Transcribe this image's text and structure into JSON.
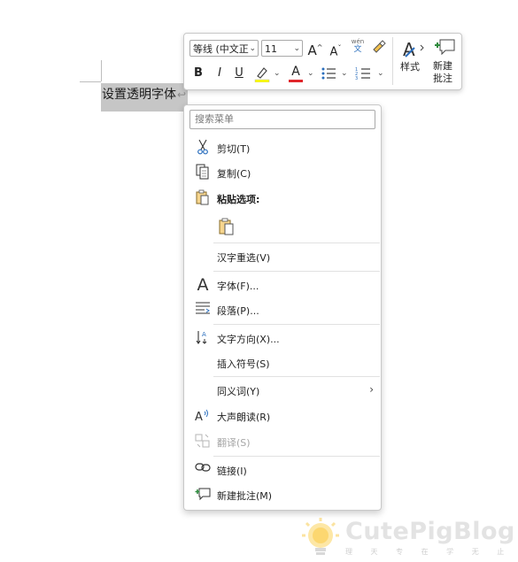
{
  "document": {
    "selected_text": "设置透明字体",
    "paragraph_mark": "↩"
  },
  "mini_toolbar": {
    "font_name": "等线 (中文正",
    "font_size": "11",
    "grow_font_icon": "grow-font-icon",
    "shrink_font_icon": "shrink-font-icon",
    "phonetic_guide_icon": "phonetic-guide-icon",
    "format_painter_icon": "format-painter-icon",
    "bold_label": "B",
    "italic_label": "I",
    "underline_label": "U",
    "styles_label": "样式",
    "new_comment_line1": "新建",
    "new_comment_line2": "批注",
    "phonetic_top": "wén",
    "phonetic_bottom": "文",
    "font_color": "#e0262b",
    "highlight_color": "#ffff00"
  },
  "context_menu": {
    "search_placeholder": "搜索菜单",
    "items": [
      {
        "label": "剪切(T)",
        "icon": "scissors-icon"
      },
      {
        "label": "复制(C)",
        "icon": "copy-icon"
      },
      {
        "label": "粘贴选项:",
        "icon": "clipboard-icon"
      },
      {
        "label": "汉字重选(V)",
        "icon": ""
      },
      {
        "label": "字体(F)...",
        "icon": "font-icon"
      },
      {
        "label": "段落(P)...",
        "icon": "paragraph-icon"
      },
      {
        "label": "文字方向(X)...",
        "icon": "text-direction-icon"
      },
      {
        "label": "插入符号(S)",
        "icon": ""
      },
      {
        "label": "同义词(Y)",
        "icon": ""
      },
      {
        "label": "大声朗读(R)",
        "icon": "read-aloud-icon"
      },
      {
        "label": "翻译(S)",
        "icon": "translate-icon"
      },
      {
        "label": "链接(I)",
        "icon": "link-icon"
      },
      {
        "label": "新建批注(M)",
        "icon": "new-comment-icon"
      }
    ]
  },
  "watermark": {
    "brand": "CutePigBlog",
    "tagline": "理 天 专 在 学 无 止 境"
  }
}
